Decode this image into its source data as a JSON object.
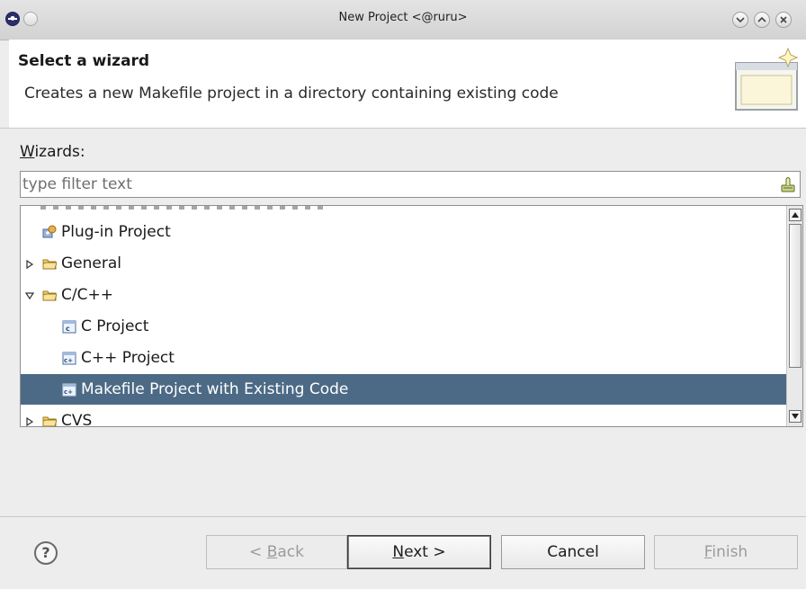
{
  "window": {
    "title": "New Project  <@ruru>"
  },
  "header": {
    "title": "Select a wizard",
    "description": "Creates a new Makefile project in a directory containing existing code"
  },
  "wizards": {
    "label_mnemonic": "W",
    "label_rest": "izards:",
    "filter_placeholder": "type filter text",
    "filter_value": ""
  },
  "tree": {
    "items": [
      {
        "label": "Plug-in Project",
        "icon": "plugin-project-icon",
        "expanded": null,
        "selected": false
      },
      {
        "label": "General",
        "icon": "folder-icon",
        "expanded": false,
        "selected": false
      },
      {
        "label": "C/C++",
        "icon": "folder-icon",
        "expanded": true,
        "selected": false
      },
      {
        "label": "C Project",
        "icon": "c-project-icon",
        "expanded": null,
        "selected": false
      },
      {
        "label": "C++ Project",
        "icon": "cpp-project-icon",
        "expanded": null,
        "selected": false
      },
      {
        "label": "Makefile Project with Existing Code",
        "icon": "makefile-project-icon",
        "expanded": null,
        "selected": true
      },
      {
        "label": "CVS",
        "icon": "folder-icon",
        "expanded": false,
        "selected": false
      }
    ]
  },
  "buttons": {
    "help": "?",
    "back_prefix": "< ",
    "back_mnemonic": "B",
    "back_rest": "ack",
    "next_mnemonic": "N",
    "next_rest": "ext >",
    "cancel": "Cancel",
    "finish_mnemonic": "F",
    "finish_rest": "inish"
  },
  "colors": {
    "selection": "#4c6a85",
    "dialog_bg": "#ededed"
  }
}
